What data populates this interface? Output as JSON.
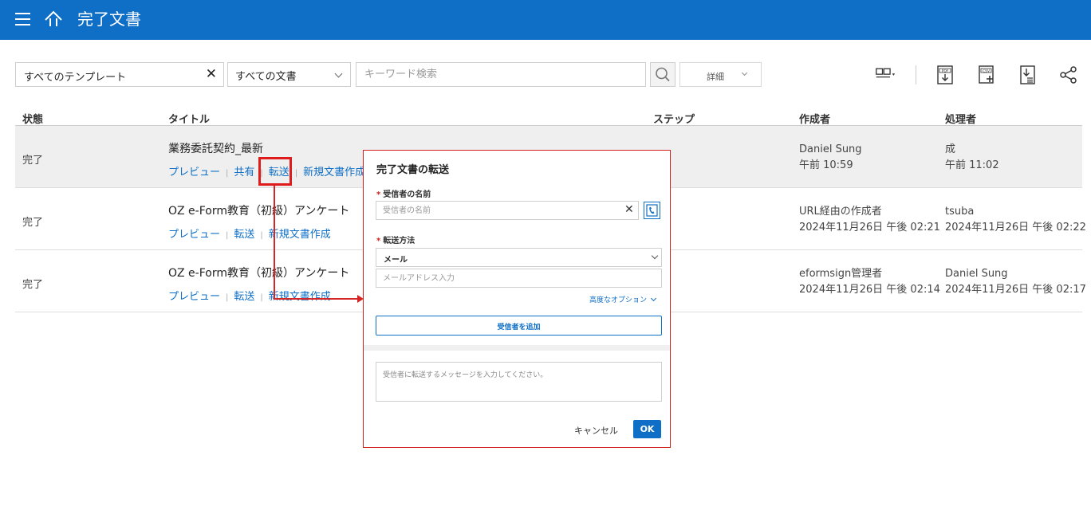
{
  "header": {
    "title": "完了文書"
  },
  "toolbar": {
    "template_filter": "すべてのテンプレート",
    "template_clear": "✕",
    "document_filter": "すべての文書",
    "search_placeholder": "キーワード検索",
    "detail_label": "詳細",
    "icons": [
      "layout-icon",
      "pdf-download-icon",
      "csv-export-icon",
      "list-download-icon",
      "share-icon"
    ]
  },
  "table": {
    "columns": {
      "status": "状態",
      "title": "タイトル",
      "step": "ステップ",
      "creator": "作成者",
      "processor": "処理者"
    },
    "rows": [
      {
        "status": "完了",
        "title": "業務委託契約_最新",
        "links": [
          "プレビュー",
          "共有",
          "転送",
          "新規文書作成"
        ],
        "creator_name": "Daniel Sung",
        "creator_time": "午前 10:59",
        "processor_name": "成",
        "processor_time": "午前 11:02"
      },
      {
        "status": "完了",
        "title": "OZ e-Form教育（初級）アンケート",
        "links": [
          "プレビュー",
          "転送",
          "新規文書作成"
        ],
        "creator_name": "URL経由の作成者",
        "creator_time": "2024年11月26日 午後 02:21",
        "processor_name": "tsuba",
        "processor_time": "2024年11月26日 午後 02:22"
      },
      {
        "status": "完了",
        "title": "OZ e-Form教育（初級）アンケート",
        "links": [
          "プレビュー",
          "転送",
          "新規文書作成"
        ],
        "creator_name": "eformsign管理者",
        "creator_time": "2024年11月26日 午後 02:14",
        "processor_name": "Daniel Sung",
        "processor_time": "2024年11月26日 午後 02:17"
      }
    ]
  },
  "dialog": {
    "title": "完了文書の転送",
    "required_mark": "*",
    "recipient_label": "受信者の名前",
    "recipient_placeholder": "受信者の名前",
    "recipient_clear": "✕",
    "method_label": "転送方法",
    "method_value": "メール",
    "email_placeholder": "メールアドレス入力",
    "advanced_label": "高度なオプション",
    "add_recipient": "受信者を追加",
    "message_placeholder": "受信者に転送するメッセージを入力してください。",
    "cancel": "キャンセル",
    "ok": "OK"
  },
  "colors": {
    "primary": "#0f6fc6",
    "annotation": "#e01b1b",
    "row_highlight": "#efefef"
  }
}
